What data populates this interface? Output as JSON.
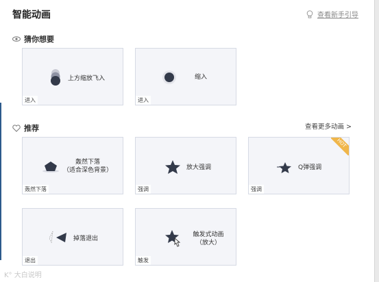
{
  "title": "智能动画",
  "guide_label": "查看新手引导",
  "sections": {
    "guess": "猜你想要",
    "recommend": "推荐"
  },
  "more_label": "查看更多动画 >",
  "cards": [
    {
      "name": "上方缩放飞入",
      "tag": "进入",
      "icon": "stacked-dots-icon"
    },
    {
      "name": "缩入",
      "tag": "进入",
      "icon": "shrink-circle-icon"
    },
    {
      "name": "轰然下落\n（适合深色背景）",
      "tag": "轰然下落",
      "icon": "pentagon-burst-icon"
    },
    {
      "name": "放大强调",
      "tag": "强调",
      "icon": "star-icon"
    },
    {
      "name": "Q弹强调",
      "tag": "强调",
      "icon": "bouncy-star-icon",
      "badge": "HOT"
    },
    {
      "name": "掉落退出",
      "tag": "退出",
      "icon": "falling-triangle-icon"
    },
    {
      "name": "触发式动画\n（放大）",
      "tag": "触发",
      "icon": "cursor-star-icon"
    }
  ],
  "watermark": "K° 大白说明",
  "colors": {
    "accent": "#333a4a",
    "card_bg": "#f4f5f9",
    "hot": "#f0b64a"
  }
}
